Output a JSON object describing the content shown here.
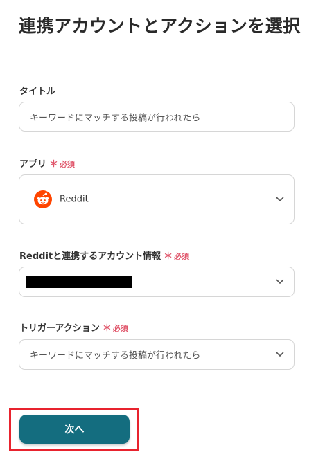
{
  "page": {
    "title": "連携アカウントとアクションを選択"
  },
  "fields": {
    "title_field": {
      "label": "タイトル",
      "value": "キーワードにマッチする投稿が行われたら"
    },
    "app_field": {
      "label": "アプリ",
      "required_mark": "＊",
      "required_text": "必須",
      "value": "Reddit",
      "icon": "reddit-logo"
    },
    "account_field": {
      "label": "Redditと連携するアカウント情報",
      "required_mark": "＊",
      "required_text": "必須",
      "value_redacted": true
    },
    "trigger_field": {
      "label": "トリガーアクション",
      "required_mark": "＊",
      "required_text": "必須",
      "value": "キーワードにマッチする投稿が行われたら"
    }
  },
  "next_button": {
    "label": "次へ"
  },
  "colors": {
    "primary": "#146d7f",
    "required": "#e0556a",
    "highlight": "#e8232e",
    "reddit": "#ff4500"
  }
}
